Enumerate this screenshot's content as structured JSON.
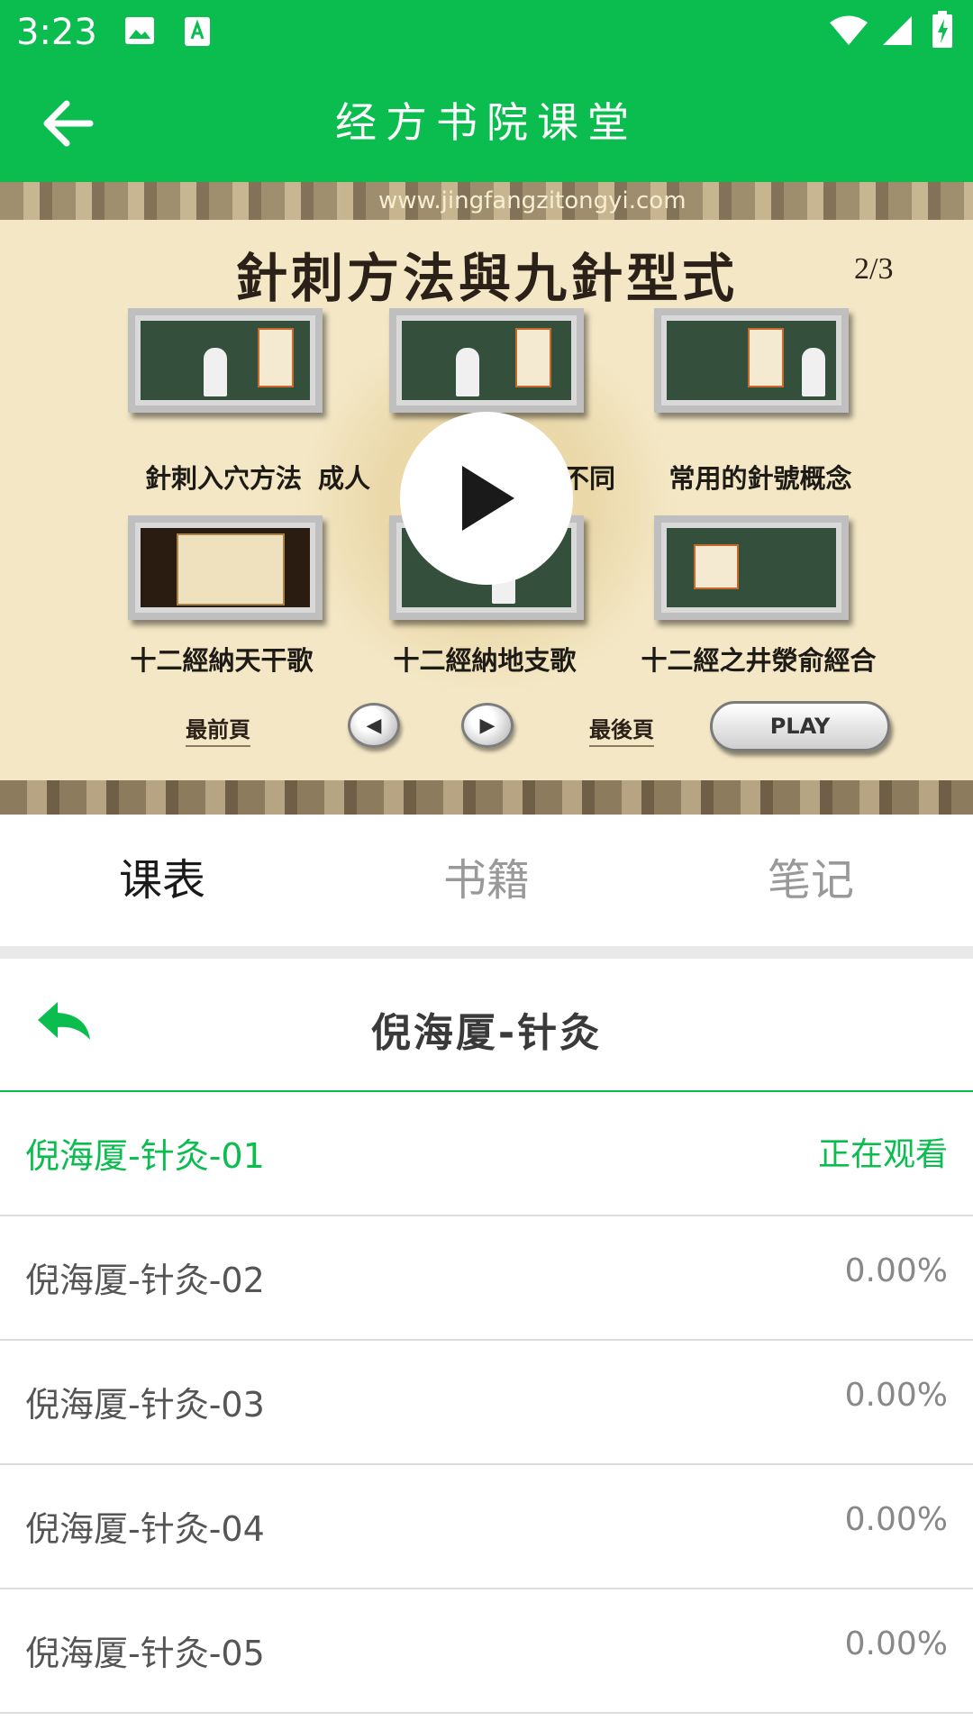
{
  "status_bar": {
    "time": "3:23",
    "icons": [
      "image-icon",
      "text-a-icon",
      "wifi-icon",
      "signal-icon",
      "battery-charging-icon"
    ]
  },
  "app_bar": {
    "title": "经方书院课堂",
    "back_icon": "arrow-left-icon"
  },
  "video": {
    "slide_title": "針刺方法與九針型式",
    "slide_page": "2/3",
    "watermark": "www.jingfangzitongyi.com",
    "thumbnails": [
      {
        "label": "針刺入穴方法"
      },
      {
        "label": "成人"
      },
      {
        "label": "不同"
      },
      {
        "label": "常用的針號概念"
      },
      {
        "label": "十二經納天干歌"
      },
      {
        "label": "十二經納地支歌"
      },
      {
        "label": "十二經之井滎俞經合"
      }
    ],
    "nav": {
      "first_page": "最前頁",
      "prev_symbol": "◀",
      "next_symbol": "▶",
      "last_page": "最後頁",
      "play": "PLAY"
    },
    "play_icon": "play-icon"
  },
  "tabs": [
    {
      "label": "课表",
      "active": true
    },
    {
      "label": "书籍",
      "active": false
    },
    {
      "label": "笔记",
      "active": false
    }
  ],
  "course": {
    "title": "倪海厦-针灸",
    "back_icon": "reply-arrow-icon"
  },
  "lessons": [
    {
      "title": "倪海厦-针灸-01",
      "status": "正在观看",
      "active": true
    },
    {
      "title": "倪海厦-针灸-02",
      "status": "0.00%",
      "active": false
    },
    {
      "title": "倪海厦-针灸-03",
      "status": "0.00%",
      "active": false
    },
    {
      "title": "倪海厦-针灸-04",
      "status": "0.00%",
      "active": false
    },
    {
      "title": "倪海厦-针灸-05",
      "status": "0.00%",
      "active": false
    }
  ],
  "colors": {
    "brand_green": "#0bbd4f",
    "inactive_tab": "#999999",
    "divider": "#dcdcdc"
  }
}
